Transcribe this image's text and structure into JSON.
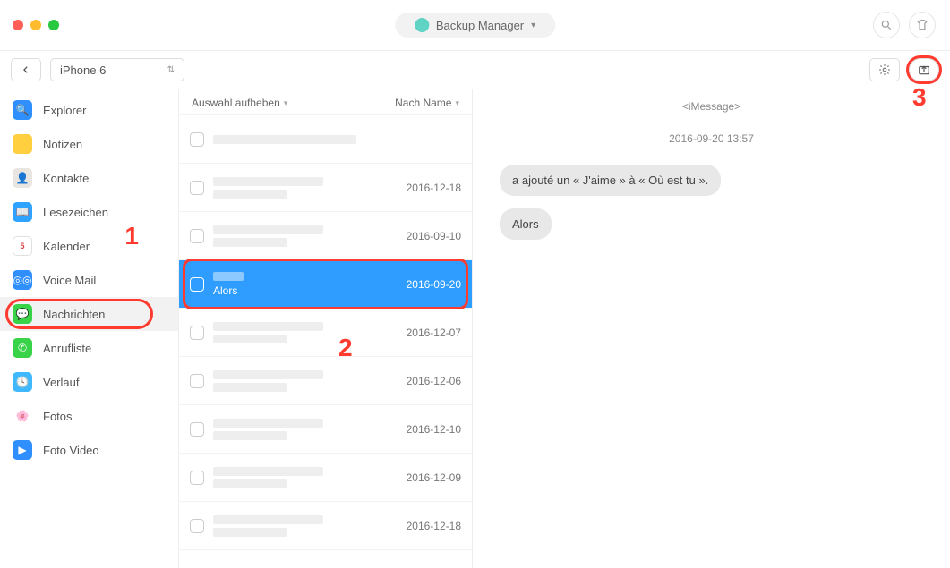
{
  "titlebar": {
    "app_label": "Backup Manager"
  },
  "toolbar": {
    "device": "iPhone 6"
  },
  "sidebar": {
    "items": [
      {
        "label": "Explorer"
      },
      {
        "label": "Notizen"
      },
      {
        "label": "Kontakte"
      },
      {
        "label": "Lesezeichen"
      },
      {
        "label": "Kalender"
      },
      {
        "label": "Voice Mail"
      },
      {
        "label": "Nachrichten"
      },
      {
        "label": "Anrufliste"
      },
      {
        "label": "Verlauf"
      },
      {
        "label": "Fotos"
      },
      {
        "label": "Foto Video"
      }
    ]
  },
  "list": {
    "head_select": "Auswahl aufheben",
    "head_sort": "Nach Name",
    "rows": [
      {
        "date": ""
      },
      {
        "date": "2016-12-18"
      },
      {
        "date": "2016-09-10"
      },
      {
        "date": "2016-09-20",
        "selected": true,
        "preview": "Alors"
      },
      {
        "date": "2016-12-07"
      },
      {
        "date": "2016-12-06"
      },
      {
        "date": "2016-12-10"
      },
      {
        "date": "2016-12-09"
      },
      {
        "date": "2016-12-18"
      }
    ]
  },
  "detail": {
    "channel": "<iMessage>",
    "timestamp": "2016-09-20 13:57",
    "bubbles": [
      "a ajouté un « J'aime » à « Où est tu  ».",
      "Alors"
    ]
  },
  "annotations": {
    "one": "1",
    "two": "2",
    "three": "3"
  }
}
